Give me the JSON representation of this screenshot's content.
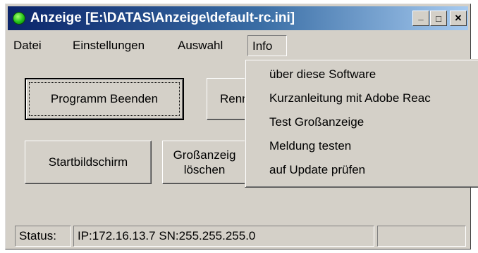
{
  "window": {
    "title": "Anzeige [E:\\DATAS\\Anzeige\\default-rc.ini]",
    "icon": "green-circle-icon",
    "controls": {
      "minimize": "_",
      "maximize": "□",
      "close": "✕"
    }
  },
  "menu": {
    "items": [
      "Datei",
      "Einstellungen",
      "Auswahl",
      "Info"
    ],
    "open_item": "Info"
  },
  "buttons": {
    "exit": "Programm Beenden",
    "rename": "Renn",
    "start_screen": "Startbildschirm",
    "clear_large_line1": "Großanzeig",
    "clear_large_line2": "löschen"
  },
  "info_menu": {
    "items": [
      "über diese Software",
      "Kurzanleitung mit Adobe Reac",
      "Test Großanzeige",
      "Meldung testen",
      "auf Update prüfen"
    ]
  },
  "status": {
    "label": "Status:",
    "text": "IP:172.16.13.7 SN:255.255.255.0",
    "extra": ""
  }
}
